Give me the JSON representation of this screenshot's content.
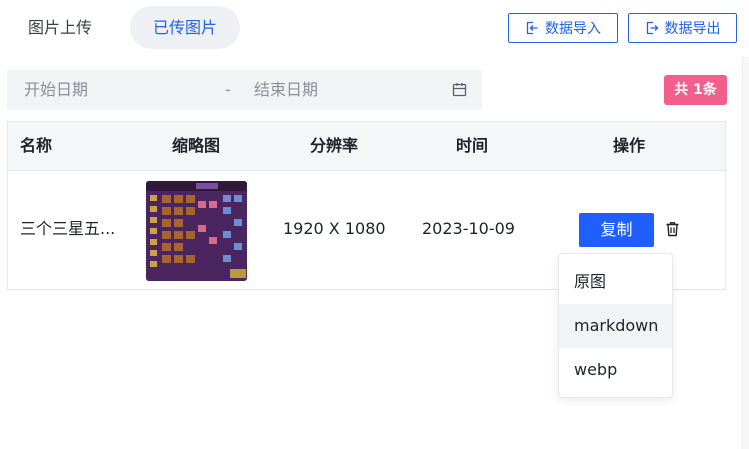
{
  "tabs": {
    "upload": "图片上传",
    "uploaded": "已传图片"
  },
  "toolbar": {
    "import_label": "数据导入",
    "export_label": "数据导出"
  },
  "date_range": {
    "start_placeholder": "开始日期",
    "separator": "-",
    "end_placeholder": "结束日期"
  },
  "count_badge": "共 1条",
  "table": {
    "headers": {
      "name": "名称",
      "thumbnail": "缩略图",
      "resolution": "分辨率",
      "time": "时间",
      "actions": "操作"
    },
    "rows": [
      {
        "name": "三个三星五...",
        "resolution": "1920 X 1080",
        "time": "2023-10-09",
        "copy_label": "复制"
      }
    ]
  },
  "copy_menu": {
    "items": [
      "原图",
      "markdown",
      "webp"
    ],
    "hovered_index": 1
  },
  "colors": {
    "accent": "#1f5fff",
    "badge": "#f35f8c"
  }
}
